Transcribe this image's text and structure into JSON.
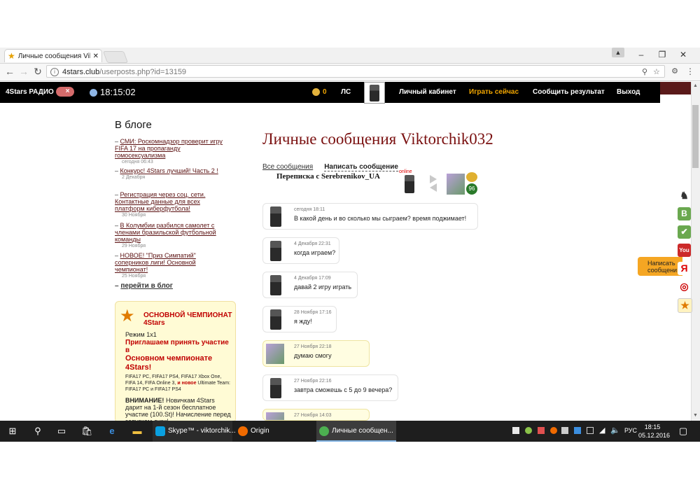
{
  "browser": {
    "tab_title": "Личные сообщения Vik",
    "url_host": "4stars.club",
    "url_path": "/userposts.php?id=13159"
  },
  "header": {
    "radio": "4Stars РАДИО",
    "time": "18:15:02",
    "coins": "0",
    "ls": "ЛС",
    "nav": [
      "Личный кабинет",
      "Играть сейчас",
      "Сообщить результат",
      "Выход"
    ],
    "highlight_color": "#f0a500"
  },
  "sidebar": {
    "title": "В блоге",
    "items": [
      {
        "text": "СМИ: Роскомнадзор проверит игру FIFA 17 на пропаганду гомосексуализма",
        "date": "сегодня 06:43"
      },
      {
        "text": "Конкурс! 4Stars лучший! Часть 2 !",
        "date": "2 Декабря"
      },
      {
        "text": "Регистрация через соц. сети. Контактные данные для всех платформ киберфутбола!",
        "date": "30 Ноября"
      },
      {
        "text": "В Колумбии разбился самолет с членами бразильской футбольной команды",
        "date": "29 Ноября"
      },
      {
        "text": "НОВОЕ! \"Приз Симпатий\" соперников лиги! Основной чемпионат!",
        "date": "25 Ноября"
      }
    ],
    "more": "перейти в блог",
    "champ": {
      "title": "ОСНОВНОЙ ЧЕМПИОНАТ 4Stars",
      "mode": "Режим 1x1",
      "invite": "Приглашаем принять участие в",
      "big": "Основном чемпионате 4Stars!",
      "platforms_a": "FIFA17 PC, FIFA17 PS4, FIFA17 Xbox One, FIFA 14, FIFA Online 3,",
      "platforms_new": "и новое",
      "platforms_b": "Ultimate Team: FIFA17 PC и FIFA17 PS4",
      "warn_bold": "ВНИМАНИЕ!",
      "warn_text": "Новичкам 4Stars дарит на 1-й сезон бесплатное участие (100.St)! Начисление перед запуском лиги!"
    }
  },
  "main": {
    "title": "Личные сообщения Viktorchik032",
    "tab_all": "Все сообщения",
    "tab_write": "Написать сообщение",
    "conversation": "Переписка с Serebrenikov_UA",
    "online": "online",
    "messages": [
      {
        "date": "сегодня 18:11",
        "text": "В какой день и во сколько мы сыграем? время поджимает!",
        "from": "me"
      },
      {
        "date": "4 Декабря 22:31",
        "text": "когда играем?",
        "from": "me"
      },
      {
        "date": "4 Декабря 17:09",
        "text": "давай 2 игру играть",
        "from": "me"
      },
      {
        "date": "28 Ноября 17:16",
        "text": "я жду!",
        "from": "me"
      },
      {
        "date": "27 Ноября 22:18",
        "text": "думаю смогу",
        "from": "other"
      },
      {
        "date": "27 Ноября 22:16",
        "text": "завтра сможешь с 5 до 9 вечера?",
        "from": "me"
      },
      {
        "date": "27 Ноября 14:03",
        "text": "",
        "from": "other"
      }
    ]
  },
  "side_widget": {
    "write_tab": "Написать сообщени"
  },
  "taskbar": {
    "apps": [
      "Skype™ - viktorchik...",
      "Origin",
      "Личные сообщен..."
    ],
    "lang": "РУС",
    "time": "18:15",
    "date": "05.12.2016"
  }
}
